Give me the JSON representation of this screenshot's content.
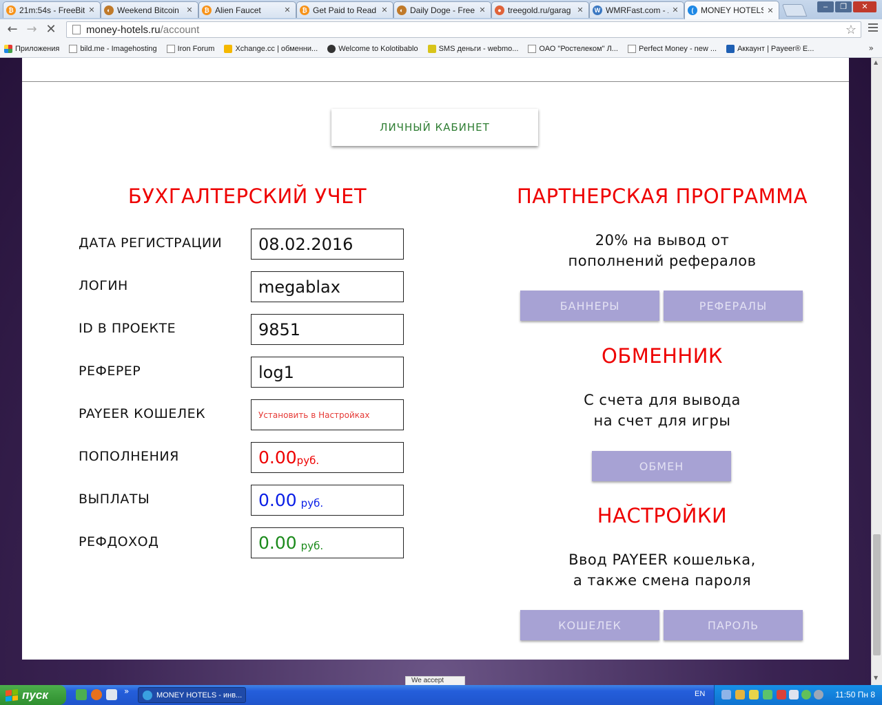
{
  "browser": {
    "tabs": [
      {
        "title": "21m:54s - FreeBit",
        "color": "#f7931a",
        "glyph": "₿"
      },
      {
        "title": "Weekend Bitcoin",
        "color": "#c07a2a",
        "glyph": "◐"
      },
      {
        "title": "Alien Faucet",
        "color": "#f7931a",
        "glyph": "₿"
      },
      {
        "title": "Get Paid to Read",
        "color": "#f7931a",
        "glyph": "₿"
      },
      {
        "title": "Daily Doge - Free",
        "color": "#c07a2a",
        "glyph": "◐"
      },
      {
        "title": "treegold.ru/garag",
        "color": "#e0633a",
        "glyph": "●"
      },
      {
        "title": "WMRFast.com - л",
        "color": "#3b78c2",
        "glyph": "W"
      },
      {
        "title": "MONEY HOTELS -",
        "color": "#1e88e5",
        "glyph": "("
      }
    ],
    "url_host": "money-hotels.ru",
    "url_path": "/account",
    "bookmarks": [
      {
        "label": "Приложения",
        "icon": "apps-grid-icon"
      },
      {
        "label": "bild.me - Imagehosting",
        "icon": "page-icon"
      },
      {
        "label": "Iron Forum",
        "icon": "page-icon"
      },
      {
        "label": "Xchange.cc | обменни...",
        "icon": "xchange-icon"
      },
      {
        "label": "Welcome to Kolotibablo",
        "icon": "kolotibablo-icon"
      },
      {
        "label": "SMS деньги - webmo...",
        "icon": "sms-icon"
      },
      {
        "label": "ОАО \"Ростелеком\" Л...",
        "icon": "page-icon"
      },
      {
        "label": "Perfect Money - new ...",
        "icon": "page-icon"
      },
      {
        "label": "Аккаунт | Payeer® E...",
        "icon": "payeer-icon"
      }
    ],
    "bookmarks_more": "»"
  },
  "page": {
    "cabinet_button": "ЛИЧНЫЙ КАБИНЕТ",
    "accounting": {
      "title": "БУХГАЛТЕРСКИЙ УЧЕТ",
      "fields": [
        {
          "label": "ДАТА РЕГИСТРАЦИИ",
          "value": "08.02.2016"
        },
        {
          "label": "ЛОГИН",
          "value": "megablax"
        },
        {
          "label": "ID В ПРОЕКТЕ",
          "value": "9851"
        },
        {
          "label": "РЕФЕРЕР",
          "value": "log1"
        },
        {
          "label": "PAYEER КОШЕЛЕК",
          "value": "Установить в Настройках"
        }
      ],
      "money": [
        {
          "label": "ПОПОЛНЕНИЯ",
          "amount": "0.00",
          "unit": "руб.",
          "color": "#ee0000"
        },
        {
          "label": "ВЫПЛАТЫ",
          "amount": "0.00",
          "unit": "руб.",
          "color": "#0a1ee6"
        },
        {
          "label": "РЕФДОХОД",
          "amount": "0.00",
          "unit": "руб.",
          "color": "#1b8a1b"
        }
      ]
    },
    "partner": {
      "title": "ПАРТНЕРСКАЯ ПРОГРАММА",
      "desc_line1": "20% на вывод от",
      "desc_line2": "пополнений рефералов",
      "btn_banners": "БАННЕРЫ",
      "btn_referrals": "РЕФЕРАЛЫ"
    },
    "exchanger": {
      "title": "ОБМЕННИК",
      "desc_line1": "С счета для вывода",
      "desc_line2": "на счет для игры",
      "btn_exchange": "ОБМЕН"
    },
    "settings": {
      "title": "НАСТРОЙКИ",
      "desc_line1": "Ввод PAYEER кошелька,",
      "desc_line2": "а также смена пароля",
      "btn_wallet": "КОШЕЛЕК",
      "btn_password": "ПАРОЛЬ"
    },
    "toast": "We accept"
  },
  "taskbar": {
    "start_label": "пуск",
    "task_label": "MONEY HOTELS - инв...",
    "lang": "EN",
    "clock": "11:50 Пн 8"
  },
  "colors": {
    "accent_red": "#ee0000",
    "button_purple": "#a7a2d4",
    "cabinet_green": "#2e7d32"
  }
}
